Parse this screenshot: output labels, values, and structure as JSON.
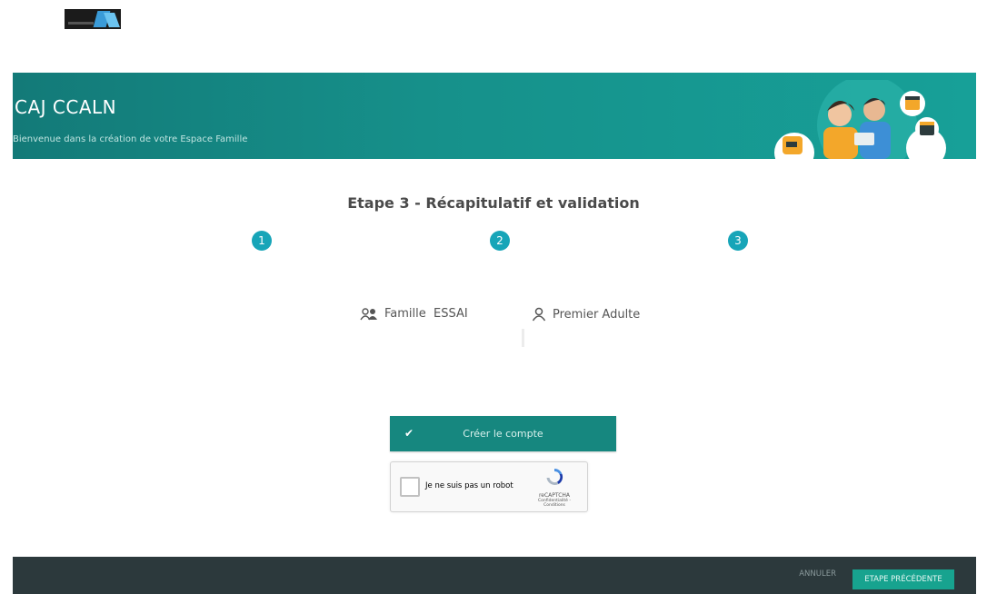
{
  "header": {
    "title": "CAJ CCALN",
    "subtitle": "Bienvenue dans la création de votre Espace Famille"
  },
  "wizard": {
    "title": "Etape 3 - Récapitulatif et validation",
    "steps": [
      "1",
      "2",
      "3"
    ],
    "current_step": 3
  },
  "summary": {
    "family_label": "Famille  ESSAI",
    "adult_label": "Premier Adulte",
    "family_icon": "family-icon",
    "adult_icon": "person-icon"
  },
  "actions": {
    "create_label": "Créer le compte",
    "create_icon": "check-icon"
  },
  "captcha": {
    "label": "Je ne suis pas un robot",
    "brand": "reCAPTCHA",
    "terms": "Confidentialité - Conditions"
  },
  "footer": {
    "cancel_label": "ANNULER",
    "previous_label": "ETAPE PRÉCÉDENTE"
  },
  "colors": {
    "brand_teal": "#16877f",
    "step_blue": "#17a5b8",
    "footer_dark": "#2c393c",
    "footer_button": "#17a38f"
  }
}
